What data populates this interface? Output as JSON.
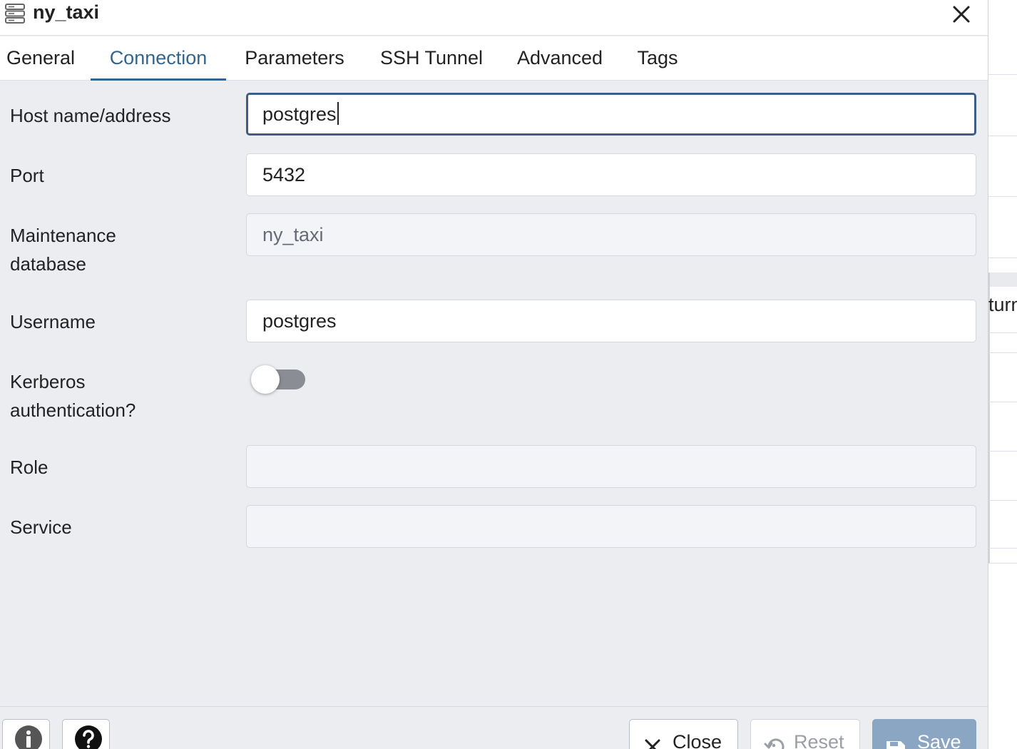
{
  "dialog": {
    "title": "ny_taxi",
    "title_icon": "server-icon",
    "close_icon": "close-icon"
  },
  "tabs": [
    {
      "label": "General",
      "active": false
    },
    {
      "label": "Connection",
      "active": true
    },
    {
      "label": "Parameters",
      "active": false
    },
    {
      "label": "SSH Tunnel",
      "active": false
    },
    {
      "label": "Advanced",
      "active": false
    },
    {
      "label": "Tags",
      "active": false
    }
  ],
  "form": {
    "host": {
      "label": "Host name/address",
      "value": "postgres"
    },
    "port": {
      "label": "Port",
      "value": "5432"
    },
    "maintenance_db": {
      "label_line1": "Maintenance",
      "label_line2": "database",
      "value": "ny_taxi"
    },
    "username": {
      "label": "Username",
      "value": "postgres"
    },
    "kerberos": {
      "label_line1": "Kerberos",
      "label_line2": "authentication?",
      "enabled": false
    },
    "role": {
      "label": "Role",
      "value": ""
    },
    "service": {
      "label": "Service",
      "value": ""
    }
  },
  "footer": {
    "info_icon": "info-icon",
    "help_icon": "help-icon",
    "close_label": "Close",
    "reset_label": "Reset",
    "save_label": "Save"
  },
  "background": {
    "partial_text": "turn"
  },
  "colors": {
    "accent": "#326690",
    "focus_border": "#3d5d86",
    "save_button": "#8aa6c3",
    "panel_bg": "#ebedf1"
  }
}
